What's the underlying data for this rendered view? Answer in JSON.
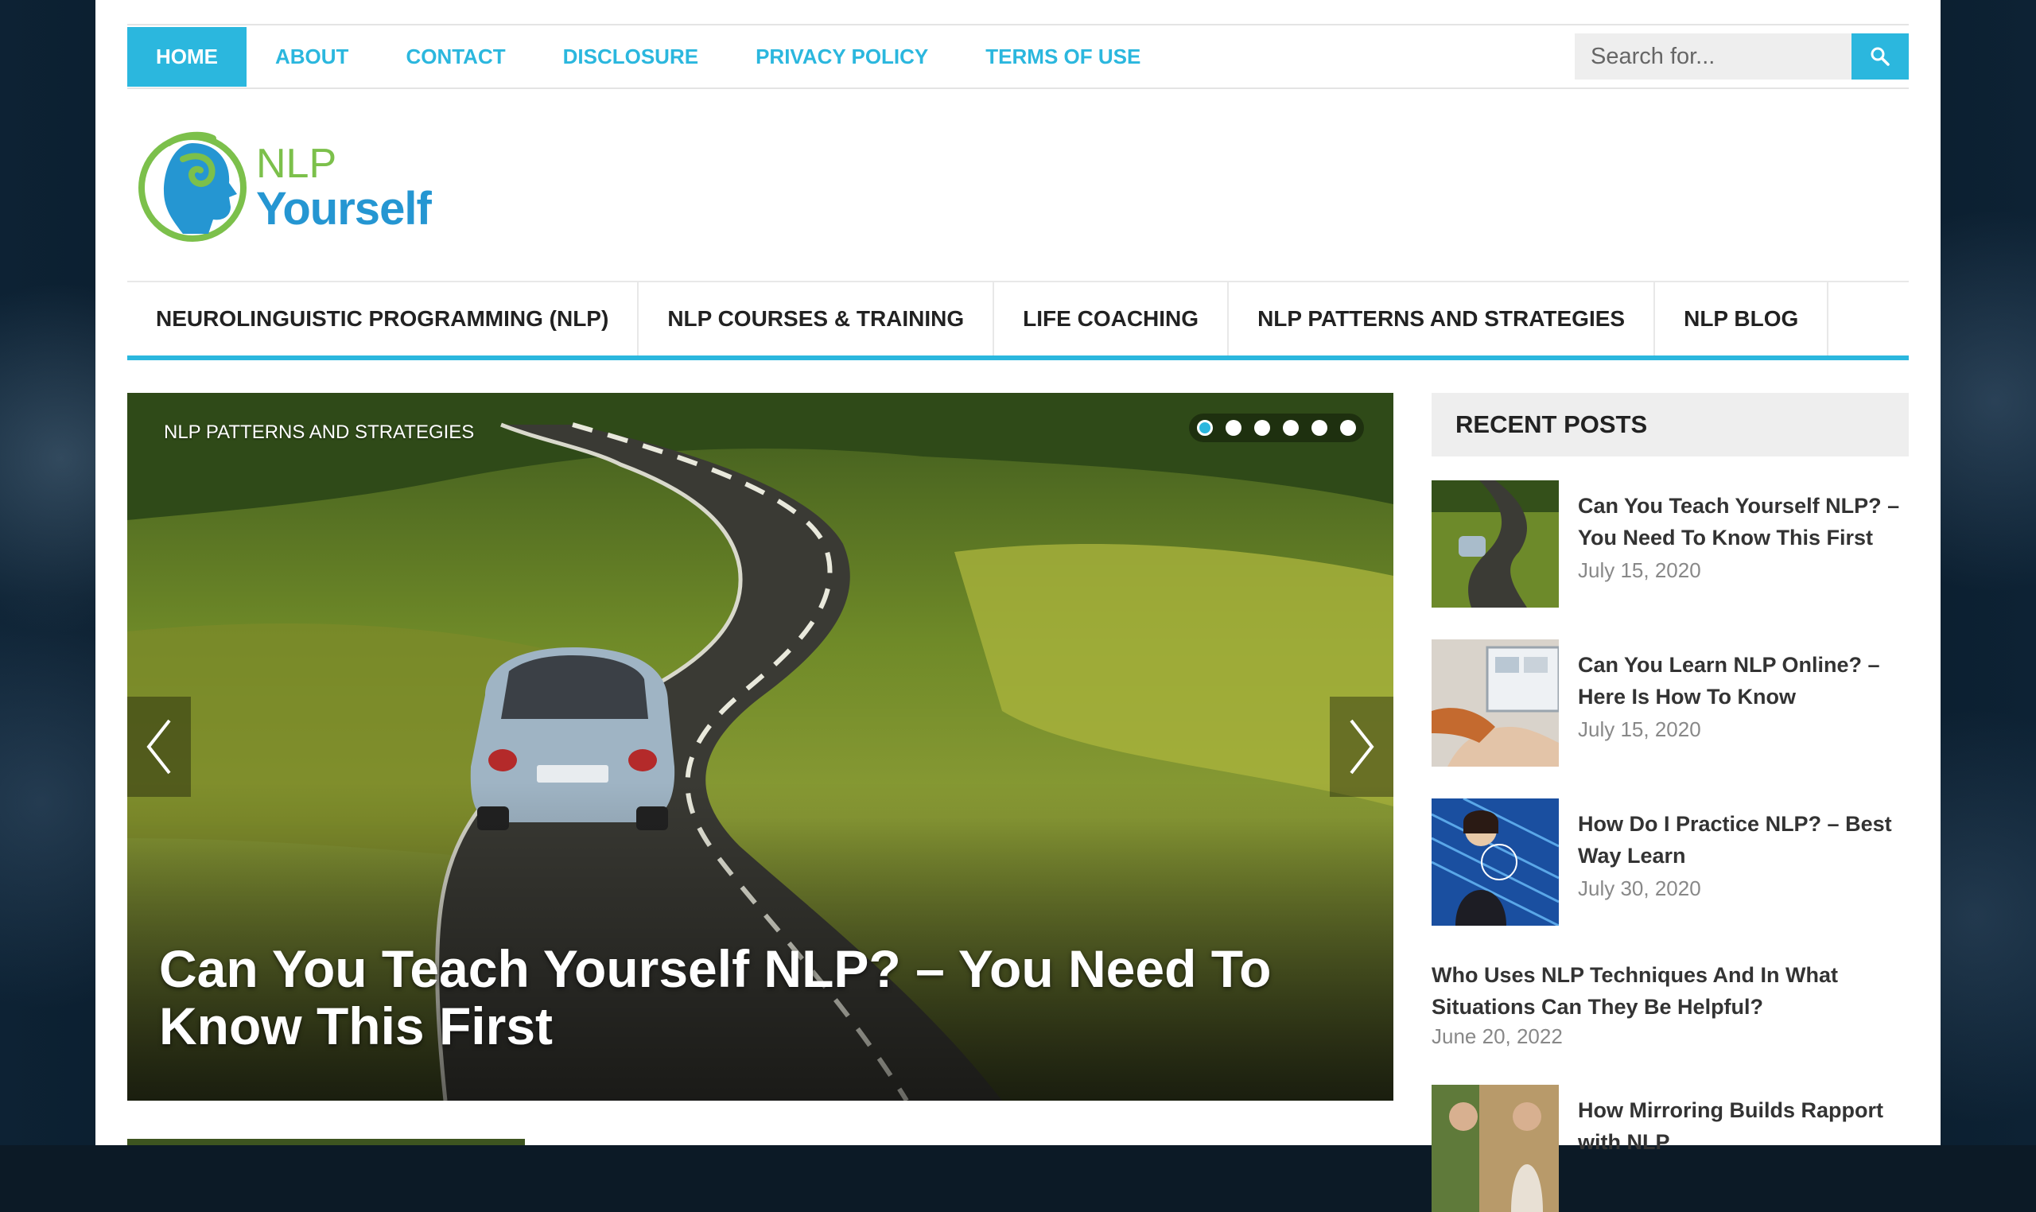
{
  "top_nav": {
    "items": [
      {
        "label": "HOME",
        "active": true
      },
      {
        "label": "ABOUT"
      },
      {
        "label": "CONTACT"
      },
      {
        "label": "DISCLOSURE"
      },
      {
        "label": "PRIVACY POLICY"
      },
      {
        "label": "TERMS OF USE"
      }
    ]
  },
  "search": {
    "placeholder": "Search for...",
    "icon": "search-icon"
  },
  "logo": {
    "line1": "NLP",
    "line2": "Yourself"
  },
  "main_nav": {
    "items": [
      {
        "label": "NEUROLINGUISTIC PROGRAMMING (NLP)"
      },
      {
        "label": "NLP COURSES & TRAINING"
      },
      {
        "label": "LIFE COACHING"
      },
      {
        "label": "NLP PATTERNS AND STRATEGIES"
      },
      {
        "label": "NLP BLOG"
      }
    ]
  },
  "slider": {
    "category": "NLP PATTERNS AND STRATEGIES",
    "title": "Can You Teach Yourself NLP? – You Need To Know This First",
    "dots_total": 6,
    "active_dot": 1
  },
  "sidebar": {
    "widget_title": "RECENT POSTS",
    "posts": [
      {
        "title": "Can You Teach Yourself NLP? – You Need To Know This First",
        "date": "July 15, 2020",
        "thumb": "road-thumb"
      },
      {
        "title": "Can You Learn NLP Online? – Here Is How To Know",
        "date": "July 15, 2020",
        "thumb": "laptop-thumb"
      },
      {
        "title": "How Do I Practice NLP? – Best Way Learn",
        "date": "July 30, 2020",
        "thumb": "skills-thumb"
      },
      {
        "title": "Who Uses NLP Techniques And In What Situations Can They Be Helpful?",
        "date": "June 20, 2022",
        "thumb": null
      },
      {
        "title": "How Mirroring Builds Rapport with NLP",
        "date": "",
        "thumb": "mirroring-thumb"
      }
    ]
  },
  "colors": {
    "accent": "#2bb7de",
    "logo_green": "#7cc04b",
    "logo_blue": "#2596d2"
  }
}
